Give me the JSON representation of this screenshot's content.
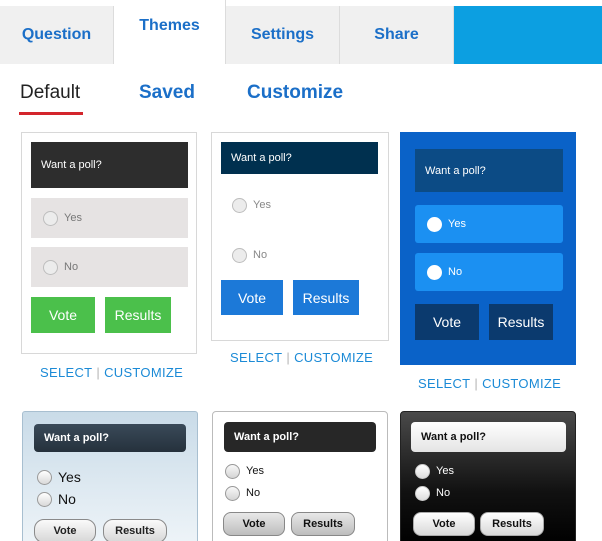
{
  "tabs": {
    "question": "Question",
    "themes": "Themes",
    "settings": "Settings",
    "share": "Share"
  },
  "subtabs": {
    "default": "Default",
    "saved": "Saved",
    "customize": "Customize"
  },
  "actions": {
    "select": "SELECT",
    "separator": "|",
    "customize": "CUSTOMIZE"
  },
  "themes": [
    {
      "question": "Want a poll?",
      "options": [
        "Yes",
        "No"
      ],
      "vote": "Vote",
      "results": "Results"
    },
    {
      "question": "Want a poll?",
      "options": [
        "Yes",
        "No"
      ],
      "vote": "Vote",
      "results": "Results"
    },
    {
      "question": "Want a poll?",
      "options": [
        "Yes",
        "No"
      ],
      "vote": "Vote",
      "results": "Results"
    },
    {
      "question": "Want a poll?",
      "options": [
        "Yes",
        "No"
      ],
      "vote": "Vote",
      "results": "Results"
    },
    {
      "question": "Want a poll?",
      "options": [
        "Yes",
        "No"
      ],
      "vote": "Vote",
      "results": "Results"
    },
    {
      "question": "Want a poll?",
      "options": [
        "Yes",
        "No"
      ],
      "vote": "Vote",
      "results": "Results"
    }
  ],
  "colors": {
    "accent": "#1b6fc8",
    "active_underline": "#d3252c",
    "tab_bar_fill": "#0c9fe1"
  }
}
